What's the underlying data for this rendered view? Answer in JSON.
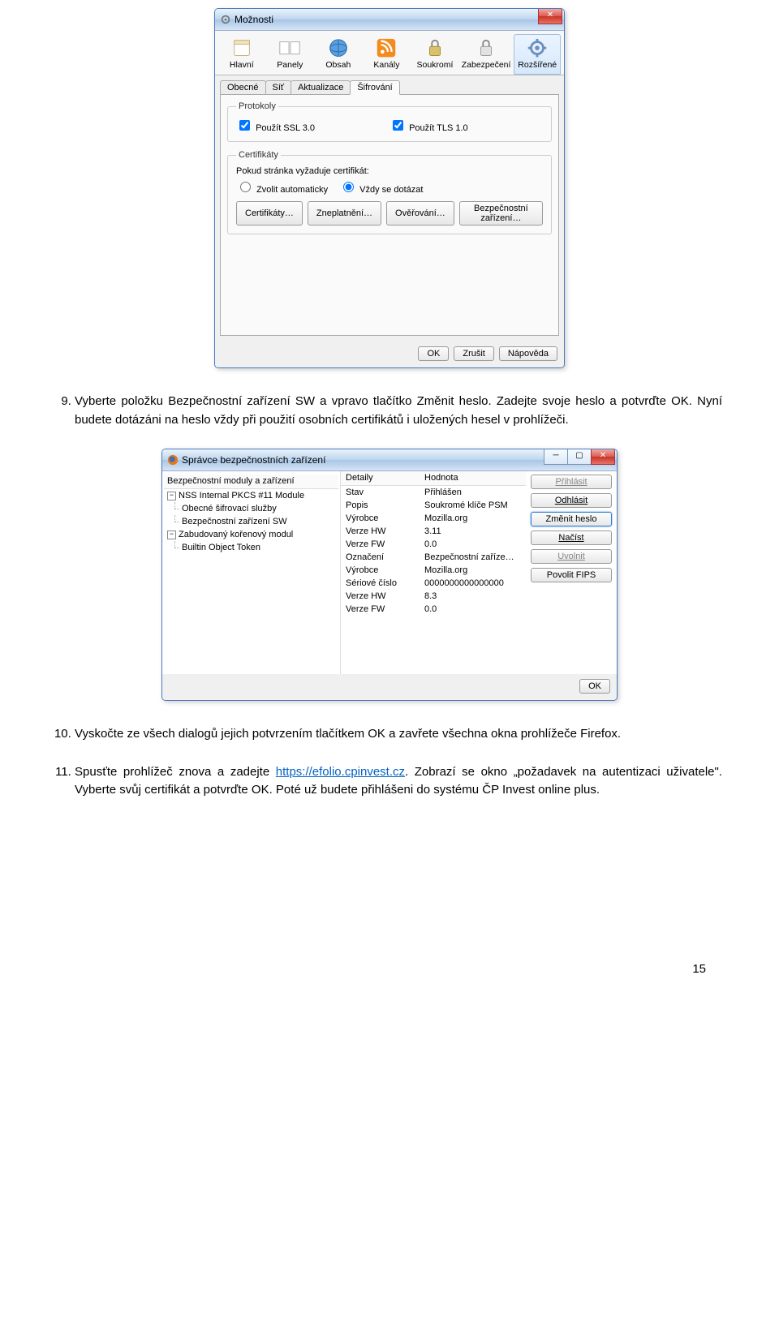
{
  "page_number": "15",
  "win1": {
    "title": "Možnosti",
    "toolbar": [
      {
        "label": "Hlavní"
      },
      {
        "label": "Panely"
      },
      {
        "label": "Obsah"
      },
      {
        "label": "Kanály"
      },
      {
        "label": "Soukromí"
      },
      {
        "label": "Zabezpečení"
      },
      {
        "label": "Rozšířené"
      }
    ],
    "tabs": [
      {
        "label": "Obecné"
      },
      {
        "label": "Síť"
      },
      {
        "label": "Aktualizace"
      },
      {
        "label": "Šifrování"
      }
    ],
    "protocols": {
      "legend": "Protokoly",
      "ssl": "Použít SSL 3.0",
      "tls": "Použít TLS 1.0"
    },
    "certs": {
      "legend": "Certifikáty",
      "prompt_label": "Pokud stránka vyžaduje certifikát:",
      "auto": "Zvolit automaticky",
      "always": "Vždy se dotázat",
      "buttons": [
        "Certifikáty…",
        "Zneplatnění…",
        "Ověřování…",
        "Bezpečnostní zařízení…"
      ]
    },
    "ok": "OK",
    "cancel": "Zrušit",
    "help": "Nápověda"
  },
  "doc": {
    "p9": "Vyberte položku Bezpečnostní zařízení SW a vpravo tlačítko Změnit heslo. Zadejte svoje heslo a potvrďte OK. Nyní budete dotázáni na heslo vždy při použití osobních certifikátů i uložených hesel v prohlížeči.",
    "p10": "Vyskočte ze všech dialogů jejich potvrzením tlačítkem OK a zavřete všechna okna prohlížeče Firefox.",
    "p11_a": "Spusťte prohlížeč znova a zadejte ",
    "p11_link": "https://efolio.cpinvest.cz",
    "p11_b": ". Zobrazí se okno „požadavek na autentizaci uživatele\". Vyberte svůj certifikát a potvrďte OK. Poté už budete přihlášeni do systému ČP Invest online plus."
  },
  "win2": {
    "title": "Správce bezpečnostních zařízení",
    "tree_header": "Bezpečnostní moduly a zařízení",
    "tree": {
      "mod1": "NSS Internal PKCS #11 Module",
      "mod1_c1": "Obecné šifrovací služby",
      "mod1_c2": "Bezpečnostní zařízení SW",
      "mod2": "Zabudovaný kořenový modul",
      "mod2_c1": "Builtin Object Token"
    },
    "details_head": {
      "c1": "Detaily",
      "c2": "Hodnota"
    },
    "details": [
      {
        "k": "Stav",
        "v": "Přihlášen"
      },
      {
        "k": "Popis",
        "v": "Soukromé klíče PSM"
      },
      {
        "k": "Výrobce",
        "v": "Mozilla.org"
      },
      {
        "k": "Verze HW",
        "v": "3.11"
      },
      {
        "k": "Verze FW",
        "v": "0.0"
      },
      {
        "k": "Označení",
        "v": "Bezpečnostní zaříze…"
      },
      {
        "k": "Výrobce",
        "v": "Mozilla.org"
      },
      {
        "k": "Sériové číslo",
        "v": "0000000000000000"
      },
      {
        "k": "Verze HW",
        "v": "8.3"
      },
      {
        "k": "Verze FW",
        "v": "0.0"
      }
    ],
    "side": {
      "login": "Přihlásit",
      "logout": "Odhlásit",
      "change": "Změnit heslo",
      "load": "Načíst",
      "release": "Uvolnit",
      "fips": "Povolit FIPS"
    },
    "ok": "OK"
  }
}
